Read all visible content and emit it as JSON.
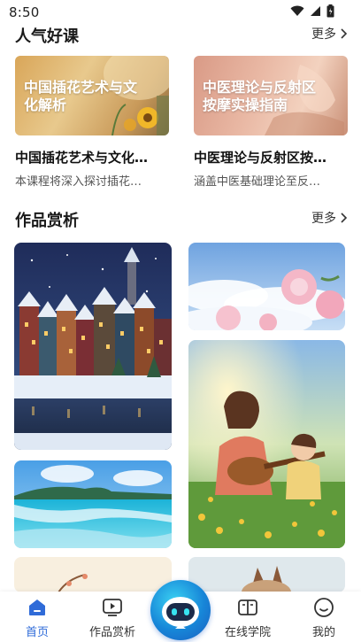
{
  "status_bar": {
    "time": "8:50"
  },
  "popular": {
    "title": "人气好课",
    "more": "更多",
    "courses": [
      {
        "thumb_text": "中国插花艺术与文化解析",
        "name": "中国插花艺术与文化…",
        "desc": "本课程将深入探讨插花…"
      },
      {
        "thumb_text": "中医理论与反射区按摩实操指南",
        "name": "中医理论与反射区按…",
        "desc": "涵盖中医基础理论至反…"
      }
    ]
  },
  "gallery": {
    "title": "作品赏析",
    "more": "更多"
  },
  "bottom_nav": {
    "items": [
      {
        "label": "首页",
        "icon": "home-icon",
        "active": true
      },
      {
        "label": "作品赏析",
        "icon": "video-icon"
      },
      {
        "label": "在线学院",
        "icon": "book-icon"
      },
      {
        "label": "我的",
        "icon": "smile-icon"
      }
    ],
    "center_icon": "robot-assistant-icon"
  },
  "colors": {
    "accent": "#2f6bd8"
  }
}
